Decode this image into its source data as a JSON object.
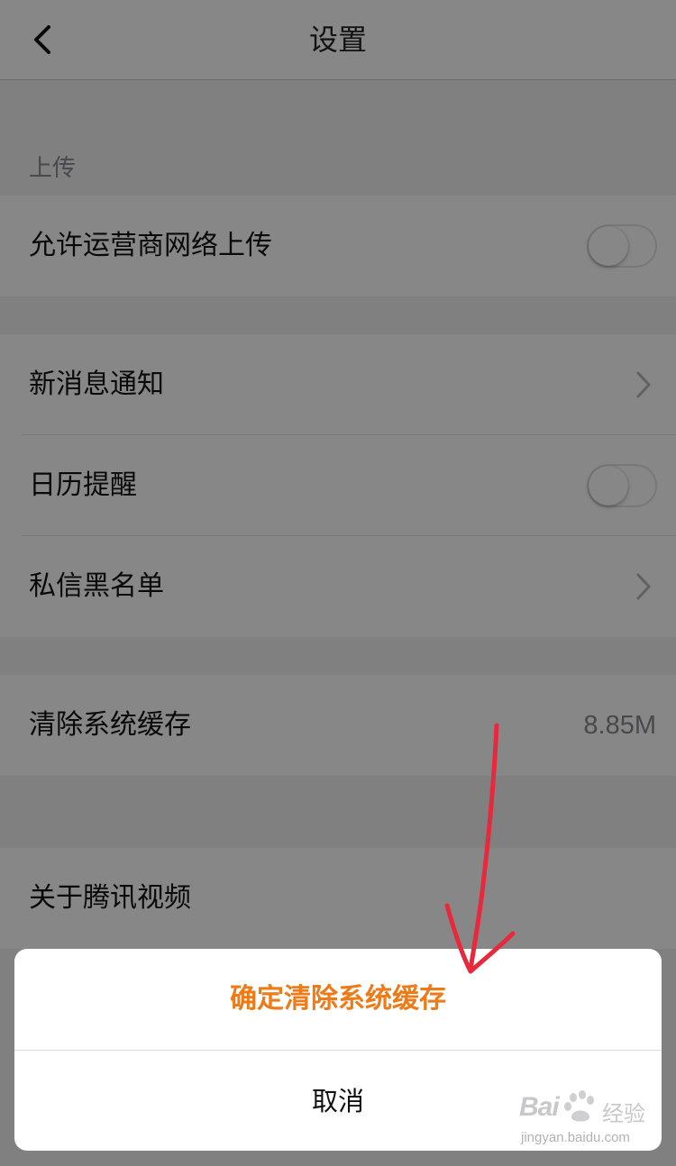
{
  "nav": {
    "title": "设置",
    "back_icon": "chevron-left-icon"
  },
  "sections": {
    "upload": {
      "header": "上传",
      "carrier_upload": {
        "label": "允许运营商网络上传",
        "toggle_on": false
      }
    },
    "notifications": {
      "new_message": {
        "label": "新消息通知"
      },
      "calendar": {
        "label": "日历提醒",
        "toggle_on": false
      },
      "blacklist": {
        "label": "私信黑名单"
      }
    },
    "storage": {
      "clear_cache": {
        "label": "清除系统缓存",
        "value": "8.85M"
      }
    },
    "about": {
      "about_app": {
        "label": "关于腾讯视频"
      }
    }
  },
  "action_sheet": {
    "confirm_label": "确定清除系统缓存",
    "cancel_label": "取消",
    "confirm_color": "#ee7a18"
  },
  "annotation": {
    "arrow_color": "#e8283c"
  },
  "watermark": {
    "brand_text": "Bai",
    "brand_suffix": "经验",
    "url": "jingyan.baidu.com"
  }
}
